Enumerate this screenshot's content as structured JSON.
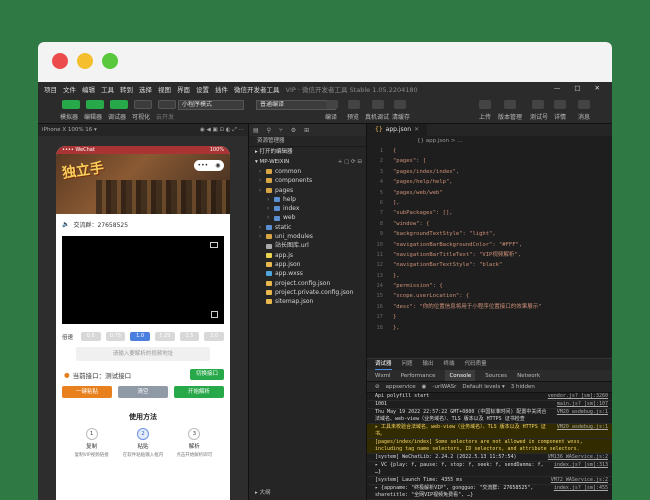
{
  "menubar": {
    "items": [
      "项目",
      "文件",
      "编辑",
      "工具",
      "转到",
      "选择",
      "视图",
      "界面",
      "设置",
      "插件",
      "微信开发者工具"
    ],
    "version": "VIP · 微信开发者工具 Stable 1.05.2204180"
  },
  "toolbar": {
    "left_labels": [
      "模拟器",
      "编辑器",
      "调试器",
      "可视化",
      "云开发"
    ],
    "mode_select": "小程序模式",
    "compile_select": "普通编译",
    "right_labels": [
      "编译",
      "预览",
      "真机调试",
      "清缓存"
    ],
    "far_right_labels": [
      "上传",
      "版本管理",
      "测试号",
      "详情",
      "消息"
    ]
  },
  "simulator": {
    "device": "iPhone X 100% 16 ▾",
    "status_time": "•••• WeChat",
    "status_right": "100%",
    "banner_title": "独立手",
    "share_text": "交流群：27658525",
    "speed_label": "倍速",
    "speeds": [
      "0.5",
      "0.75",
      "1.0",
      "1.25",
      "1.5",
      "2.0"
    ],
    "url_placeholder": "请输入要解析的视频地址",
    "current_iface": "当前接口：测试接口",
    "switch_btn": "切换接口",
    "paste_btn": "一键粘贴",
    "clear_btn": "清空",
    "parse_btn": "开始解析",
    "usage_title": "使用方法",
    "steps": [
      {
        "num": "1",
        "title": "复制",
        "desc": "复制VIP视频链接"
      },
      {
        "num": "2",
        "title": "粘贴",
        "desc": "在软件粘贴输入框内"
      },
      {
        "num": "3",
        "title": "解析",
        "desc": "点击开始解析即可"
      }
    ]
  },
  "explorer": {
    "header": "资源管理器",
    "open_editors": "打开的编辑器",
    "project": "MP-WEIXIN",
    "tree": [
      {
        "name": "common",
        "type": "folder",
        "indent": 1
      },
      {
        "name": "components",
        "type": "folder",
        "indent": 1
      },
      {
        "name": "pages",
        "type": "folder",
        "indent": 1
      },
      {
        "name": "help",
        "type": "folder",
        "indent": 2
      },
      {
        "name": "index",
        "type": "folder",
        "indent": 2
      },
      {
        "name": "web",
        "type": "folder",
        "indent": 2
      },
      {
        "name": "static",
        "type": "folder",
        "indent": 1
      },
      {
        "name": "uni_modules",
        "type": "folder",
        "indent": 1
      },
      {
        "name": "站长图库.url",
        "type": "url",
        "indent": 1
      },
      {
        "name": "app.js",
        "type": "js",
        "indent": 1
      },
      {
        "name": "app.json",
        "type": "json",
        "indent": 1
      },
      {
        "name": "app.wxss",
        "type": "wxss",
        "indent": 1
      },
      {
        "name": "project.config.json",
        "type": "json",
        "indent": 1
      },
      {
        "name": "project.private.config.json",
        "type": "json",
        "indent": 1
      },
      {
        "name": "sitemap.json",
        "type": "json",
        "indent": 1
      }
    ],
    "bottom": "▸ 大纲"
  },
  "editor": {
    "tab": "app.json",
    "crumb": "{} app.json > ...",
    "lines": [
      {
        "n": "1",
        "t": "{"
      },
      {
        "n": "2",
        "t": "  \"pages\": ["
      },
      {
        "n": "3",
        "t": "    \"pages/index/index\","
      },
      {
        "n": "4",
        "t": "    \"pages/help/help\","
      },
      {
        "n": "5",
        "t": "    \"pages/web/web\""
      },
      {
        "n": "6",
        "t": "  ],"
      },
      {
        "n": "7",
        "t": "  \"subPackages\": [],"
      },
      {
        "n": "8",
        "t": "  \"window\": {"
      },
      {
        "n": "9",
        "t": "    \"backgroundTextStyle\": \"light\","
      },
      {
        "n": "10",
        "t": "    \"navigationBarBackgroundColor\": \"#FFF\","
      },
      {
        "n": "11",
        "t": "    \"navigationBarTitleText\": \"VIP视频解析\","
      },
      {
        "n": "12",
        "t": "    \"navigationBarTextStyle\": \"black\""
      },
      {
        "n": "13",
        "t": "  },"
      },
      {
        "n": "14",
        "t": "  \"permission\": {"
      },
      {
        "n": "15",
        "t": "    \"scope.userLocation\": {"
      },
      {
        "n": "16",
        "t": "      \"desc\": \"你的位置信息将用于小程序位置接口的效果展示\""
      },
      {
        "n": "17",
        "t": "    }"
      },
      {
        "n": "18",
        "t": "  },"
      }
    ]
  },
  "devtools": {
    "tabs": [
      "调试器",
      "问题",
      "输出",
      "终端",
      "代码质量"
    ],
    "subtabs": [
      "Wxml",
      "Performance",
      "Console",
      "Sources",
      "Network"
    ],
    "filter_context": "appservice",
    "filter_text": "-urlWASr",
    "filter_levels": "Default levels ▾",
    "hidden": "3 hidden",
    "logs": [
      {
        "type": "info",
        "text": "Api polyfill start",
        "src": "vendor.js? [sm]:3260"
      },
      {
        "type": "info",
        "text": "1001",
        "src": "main.js? [sm]:107"
      },
      {
        "type": "info",
        "text": "Thu May 19 2022 22:57:22 GMT+0800 (中国标准时间) 配置中关闭合法域名、web-view（业务域名）、TLS 版本以及 HTTPS 证书检查",
        "src": "VM20 asdebug.js:1"
      },
      {
        "type": "warn",
        "text": "▸ 工具未校验合法域名、web-view（业务域名）、TLS 版本以及 HTTPS 证书。",
        "src": "VM20 asdebug.js:1"
      },
      {
        "type": "warn",
        "text": "[pages/index/index] Some selectors are not allowed in component wxss, including tag name selectors, ID selectors, and attribute selectors.",
        "src": ""
      },
      {
        "type": "info",
        "text": "[system] WeChatLib: 2.24.2 (2022.5.13 11:57:54)",
        "src": "VM136 WAService.js:2"
      },
      {
        "type": "info",
        "text": "▸ VC {play: f, pause: f, stop: f, seek: f, sendDanmu: f, …}",
        "src": "index.js? [sm]:313"
      },
      {
        "type": "info",
        "text": "[system] Launch Time: 4355 ms",
        "src": "VM72 WAService.js:2"
      },
      {
        "type": "info",
        "text": "▸ {appname: \"终极解析VIP\", gongguo: \"交流群: 27658525\", sharetitle: \"全网VIP视频免费看\", …}",
        "src": "index.js? [sm]:455"
      }
    ]
  }
}
